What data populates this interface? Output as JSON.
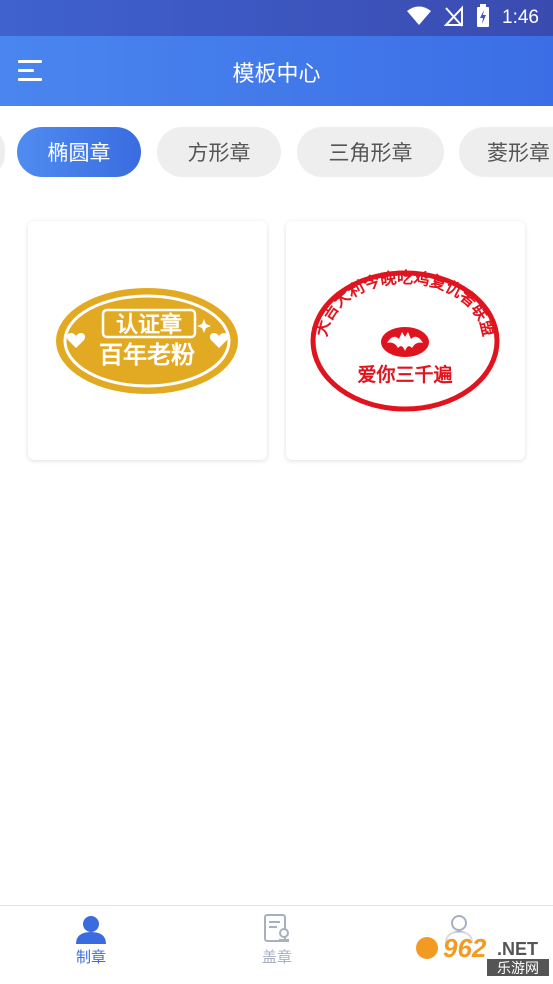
{
  "status_bar": {
    "time": "1:46",
    "icons": [
      "wifi-icon",
      "no-signal-icon",
      "battery-charging-icon"
    ]
  },
  "header": {
    "title": "模板中心",
    "menu_icon": "menu-icon"
  },
  "tabs": [
    {
      "label": "椭圆章",
      "active": true
    },
    {
      "label": "方形章",
      "active": false
    },
    {
      "label": "三角形章",
      "active": false
    },
    {
      "label": "菱形章",
      "active": false
    }
  ],
  "templates": [
    {
      "type": "oval-gold-seal",
      "color": "#e2aa22",
      "line1": "认证章",
      "line2": "百年老粉"
    },
    {
      "type": "oval-red-seal",
      "color": "#e0141e",
      "arc_text": "大吉大利今晚吃鸡复仇者联盟",
      "center_text": "爱你三千遍"
    }
  ],
  "bottom_nav": [
    {
      "label": "制章",
      "icon": "person-icon",
      "active": true
    },
    {
      "label": "盖章",
      "icon": "stamp-document-icon",
      "active": false
    },
    {
      "label": "",
      "icon": "profile-icon",
      "active": false
    }
  ],
  "watermark": {
    "number": "962",
    "suffix": ".NET",
    "text": "乐游网"
  },
  "colors": {
    "accent": "#3a6ce0",
    "gold": "#e2aa22",
    "red": "#e0141e"
  }
}
